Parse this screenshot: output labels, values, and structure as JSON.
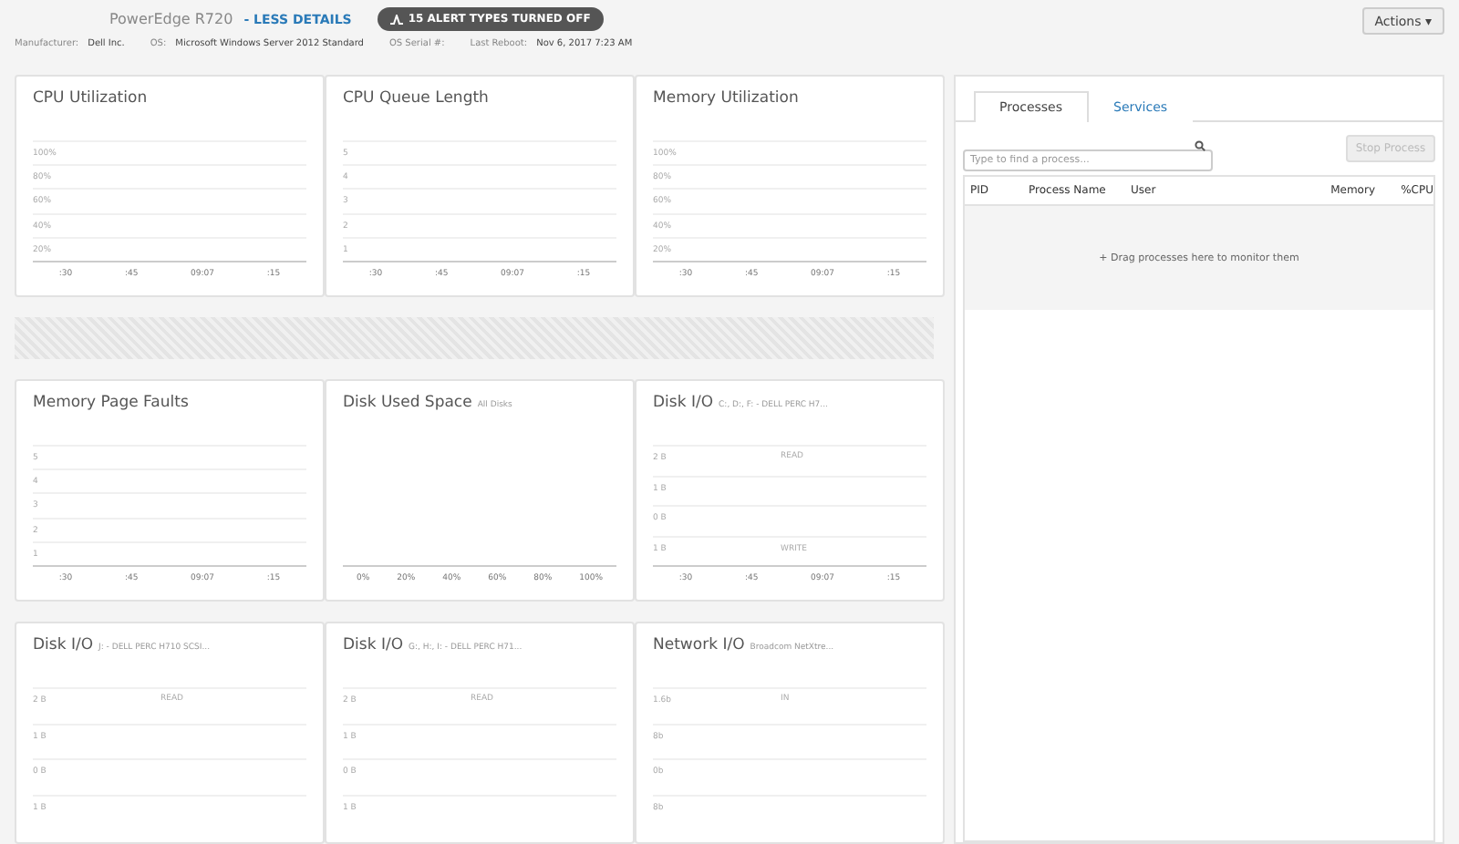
{
  "header": {
    "model": "PowerEdge R720",
    "details_link": "- LESS DETAILS",
    "alert_badge": "15 ALERT TYPES TURNED OFF",
    "actions_button": "Actions ▾",
    "info": [
      {
        "label": "Manufacturer:",
        "value": "Dell Inc."
      },
      {
        "label": "OS:",
        "value": "Microsoft Windows Server 2012 Standard"
      },
      {
        "label": "OS Serial #:"
      },
      {
        "label": "Last Reboot:",
        "value": "Nov 6, 2017 7:23 AM"
      }
    ]
  },
  "charts": [
    {
      "title": "CPU Utilization",
      "y_labels": [
        "100%",
        "80%",
        "60%",
        "40%",
        "20%"
      ],
      "x_labels": [
        ":30",
        ":45",
        "09:07",
        ":15"
      ]
    },
    {
      "title": "CPU Queue Length",
      "y_labels": [
        "5",
        "4",
        "3",
        "2",
        "1"
      ],
      "x_labels": [
        ":30",
        ":45",
        "09:07",
        ":15"
      ]
    },
    {
      "title": "Memory Utilization",
      "y_labels": [
        "100%",
        "80%",
        "60%",
        "40%",
        "20%"
      ],
      "x_labels": [
        ":30",
        ":45",
        "09:07",
        ":15"
      ]
    },
    {
      "title": "Memory Page Faults",
      "y_labels": [
        "5",
        "4",
        "3",
        "2",
        "1"
      ],
      "x_labels": [
        ":30",
        ":45",
        "09:07",
        ":15"
      ]
    },
    {
      "title": "Disk Used Space",
      "subtitle": "All Disks",
      "x_labels": [
        "0%",
        "20%",
        "40%",
        "60%",
        "80%",
        "100%"
      ]
    },
    {
      "title": "Disk I/O",
      "subtitle": "C:, D:, F: - DELL PERC H7...",
      "y_labels": [
        "2 B",
        "1 B",
        "0 B",
        "1 B"
      ],
      "top_label": "READ",
      "bottom_label": "WRITE",
      "x_labels": [
        ":30",
        ":45",
        "09:07",
        ":15"
      ]
    },
    {
      "title": "Disk I/O",
      "subtitle": "J: - DELL PERC H710 SCSI...",
      "y_labels": [
        "2 B",
        "1 B",
        "0 B",
        "1 B"
      ],
      "top_label": "READ"
    },
    {
      "title": "Disk I/O",
      "subtitle": "G:, H:, I: - DELL PERC H71...",
      "y_labels": [
        "2 B",
        "1 B",
        "0 B",
        "1 B"
      ],
      "top_label": "READ"
    },
    {
      "title": "Network I/O",
      "subtitle": "Broadcom NetXtre...",
      "y_labels": [
        "1.6b",
        "8b",
        "0b",
        "8b"
      ],
      "top_label": "IN"
    }
  ],
  "process_panel": {
    "tabs": [
      {
        "label": "Processes",
        "selected": true
      },
      {
        "label": "Services",
        "selected": false
      }
    ],
    "search": {
      "placeholder": "Type to find a process..."
    },
    "stop_button": {
      "label": "Stop Process",
      "disabled": true
    },
    "columns": [
      "PID",
      "Process Name",
      "User",
      "Memory",
      "%CPU"
    ],
    "drop_hint": "+ Drag processes here to monitor them"
  }
}
